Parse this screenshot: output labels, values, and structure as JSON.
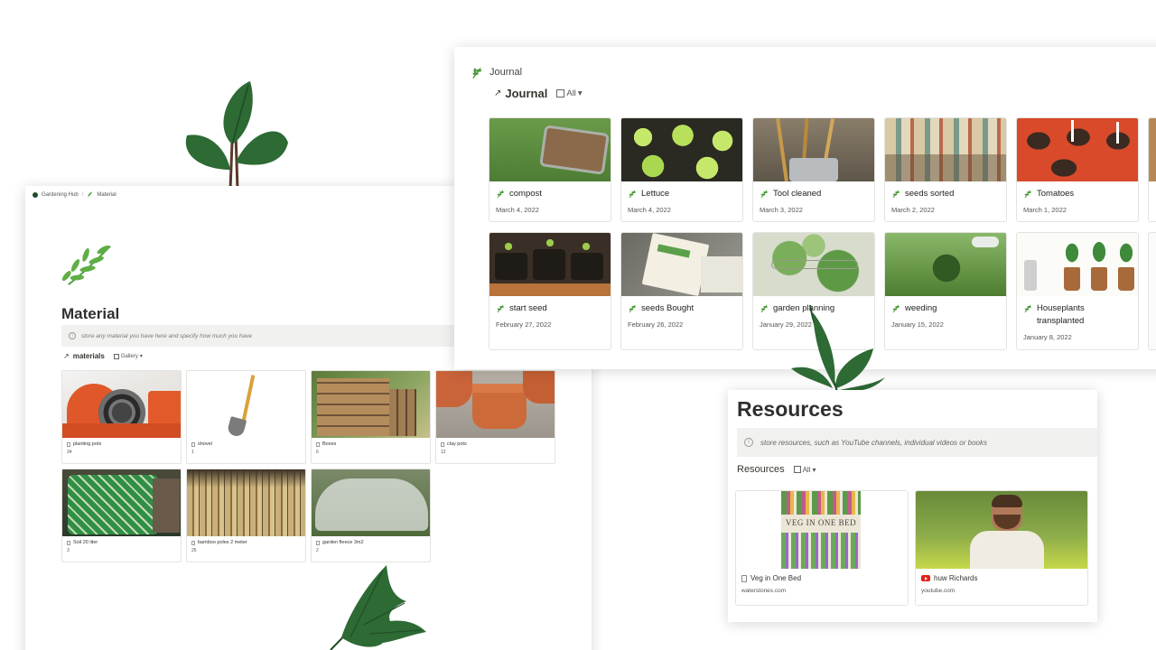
{
  "material_page": {
    "breadcrumb": {
      "workspace": "Gardening Hub",
      "separator": "/",
      "current": "Material"
    },
    "title": "Material",
    "callout": "store any material you have here and specify how much you have",
    "database": {
      "name": "materials",
      "view_label": "Gallery",
      "view_arrow": "▾"
    },
    "items": [
      {
        "name": "planting pots",
        "qty": "34"
      },
      {
        "name": "shovel",
        "qty": "1"
      },
      {
        "name": "Boxes",
        "qty": "6"
      },
      {
        "name": "clay pots",
        "qty": "12"
      },
      {
        "name": "Soil 20 liter",
        "qty": "3"
      },
      {
        "name": "bamboo poles 2 meter",
        "qty": "25"
      },
      {
        "name": "garden fleece 3m2",
        "qty": "2"
      }
    ]
  },
  "journal_page": {
    "page_label": "Journal",
    "database": {
      "name": "Journal",
      "view_label": "All",
      "view_arrow": "▾"
    },
    "entries": [
      {
        "title": "compost",
        "date": "March 4, 2022"
      },
      {
        "title": "Lettuce",
        "date": "March 4, 2022"
      },
      {
        "title": "Tool cleaned",
        "date": "March 3, 2022"
      },
      {
        "title": "seeds sorted",
        "date": "March 2, 2022"
      },
      {
        "title": "Tomatoes",
        "date": "March 1, 2022"
      },
      {
        "title": "start seed",
        "date": "February 27, 2022"
      },
      {
        "title": "seeds Bought",
        "date": "February 26, 2022"
      },
      {
        "title": "garden planning",
        "date": "January 29, 2022"
      },
      {
        "title": "weeding",
        "date": "January 15, 2022"
      },
      {
        "title": "Houseplants transplanted",
        "date": "January 8, 2022"
      }
    ]
  },
  "resources_page": {
    "title": "Resources",
    "callout": "store resources, such as YouTube channels, individual videos or books",
    "database": {
      "name": "Resources",
      "view_label": "All",
      "view_arrow": "▾"
    },
    "items": [
      {
        "name": "Veg in One Bed",
        "source": "waterstones.com",
        "icon": "document-icon",
        "book_title": "VEG IN ONE BED"
      },
      {
        "name": "huw Richards",
        "source": "youtube.com",
        "icon": "youtube-icon"
      }
    ]
  },
  "colors": {
    "accent_green": "#4a9a3a",
    "dark_leaf": "#2d6a34",
    "callout_bg": "#f1f1ef",
    "youtube_red": "#e62117"
  }
}
